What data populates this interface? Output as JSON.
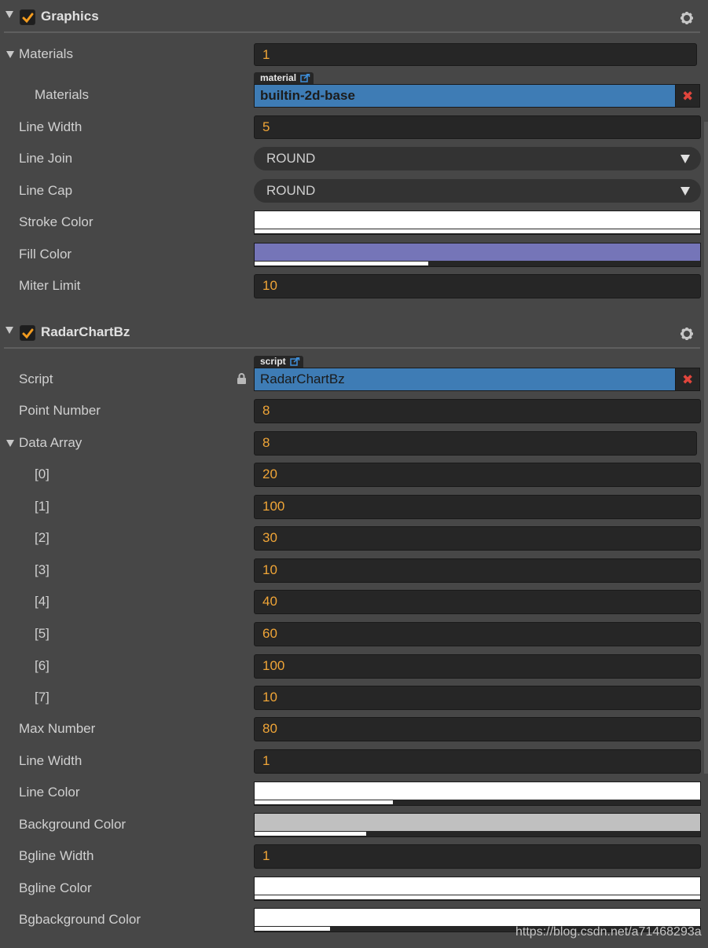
{
  "graphics": {
    "title": "Graphics",
    "enabled": true,
    "materials": {
      "label": "Materials",
      "count": "1",
      "item_label": "Materials",
      "asset_tag": "material",
      "asset_value": "builtin-2d-base"
    },
    "line_width": {
      "label": "Line Width",
      "value": "5"
    },
    "line_join": {
      "label": "Line Join",
      "value": "ROUND"
    },
    "line_cap": {
      "label": "Line Cap",
      "value": "ROUND"
    },
    "stroke_color": {
      "label": "Stroke Color",
      "color": "#ffffff",
      "alpha": 1.0
    },
    "fill_color": {
      "label": "Fill Color",
      "color": "#7575b8",
      "alpha": 0.39
    },
    "miter_limit": {
      "label": "Miter Limit",
      "value": "10"
    }
  },
  "radar": {
    "title": "RadarChartBz",
    "enabled": true,
    "script": {
      "label": "Script",
      "asset_tag": "script",
      "asset_value": "RadarChartBz"
    },
    "point_number": {
      "label": "Point Number",
      "value": "8"
    },
    "data_array": {
      "label": "Data Array",
      "count": "8",
      "items": [
        {
          "index": "[0]",
          "value": "20"
        },
        {
          "index": "[1]",
          "value": "100"
        },
        {
          "index": "[2]",
          "value": "30"
        },
        {
          "index": "[3]",
          "value": "10"
        },
        {
          "index": "[4]",
          "value": "40"
        },
        {
          "index": "[5]",
          "value": "60"
        },
        {
          "index": "[6]",
          "value": "100"
        },
        {
          "index": "[7]",
          "value": "10"
        }
      ]
    },
    "max_number": {
      "label": "Max Number",
      "value": "80"
    },
    "line_width": {
      "label": "Line Width",
      "value": "1"
    },
    "line_color": {
      "label": "Line Color",
      "color": "#ffffff",
      "alpha": 0.31
    },
    "background_color": {
      "label": "Background Color",
      "color": "#c0c0c0",
      "alpha": 0.25
    },
    "bgline_width": {
      "label": "Bgline Width",
      "value": "1"
    },
    "bgline_color": {
      "label": "Bgline Color",
      "color": "#ffffff",
      "alpha": 1.0
    },
    "bgbackground_color": {
      "label": "Bgbackground Color",
      "color": "#ffffff",
      "alpha": 0.17
    }
  },
  "watermark": "https://blog.csdn.net/a71468293a",
  "icons": {
    "checkbox": "check-icon",
    "settings": "gear-icon",
    "expand": "triangle-down-icon",
    "remove": "close-icon",
    "lock": "lock-icon",
    "link": "external-link-icon"
  },
  "colors": {
    "accent": "#f0a537",
    "asset": "#3e7cb5",
    "remove": "#e0453c"
  }
}
